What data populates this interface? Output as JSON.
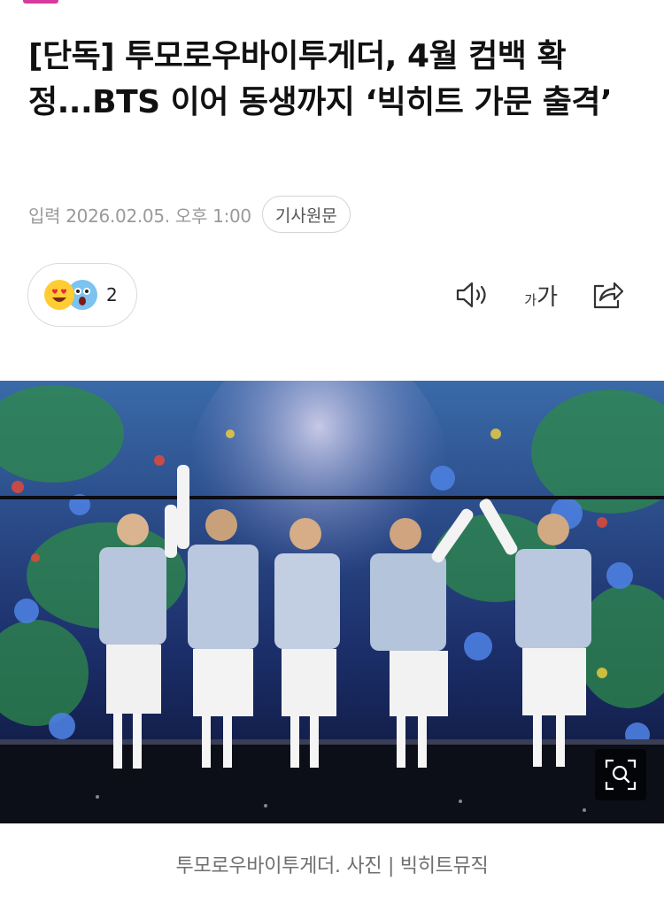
{
  "article": {
    "headline": "[단독] 투모로우바이투게더, 4월 컴백 확정...BTS 이어 동생까지 ‘빅히트 가문 출격’",
    "published": "입력 2026.02.05. 오후 1:00",
    "original_article_button": "기사원문"
  },
  "reactions": {
    "icons": [
      "heart-eyes-emoji-icon",
      "shocked-emoji-icon"
    ],
    "count": "2"
  },
  "toolbar": {
    "icons": [
      "speaker-icon",
      "font-size-icon",
      "share-icon"
    ],
    "font_size_small": "가",
    "font_size_large": "가"
  },
  "photo": {
    "caption": "투모로우바이투게더. 사진 | 빅히트뮤직",
    "zoom_icon": "zoom-icon"
  },
  "colors": {
    "accent": "#d63b9e",
    "text": "#111111",
    "meta_text": "#9a9a9a",
    "caption_text": "#6f6f6f",
    "border": "#dadada"
  }
}
